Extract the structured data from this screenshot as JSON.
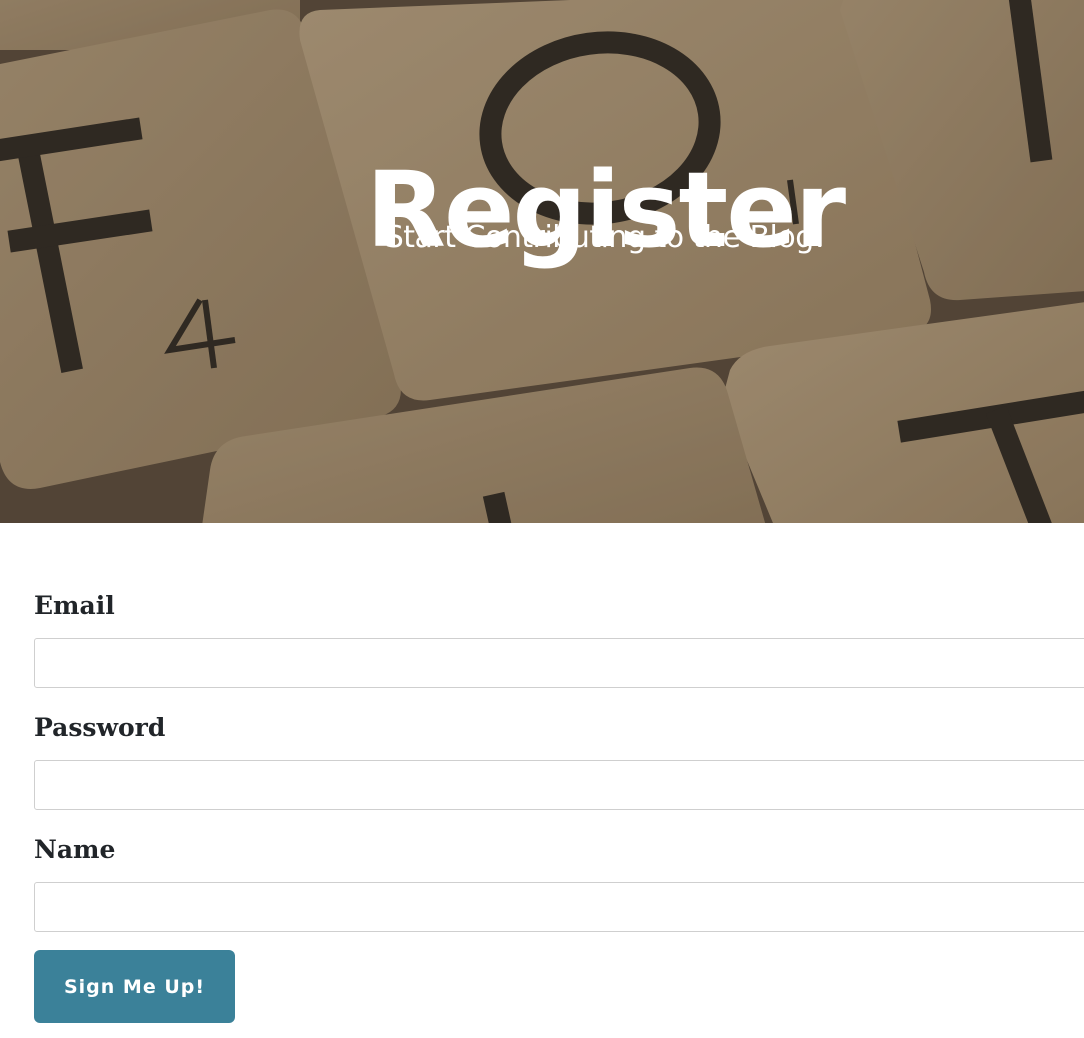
{
  "header": {
    "title": "Register",
    "subtitle": "Start Contributing to the Blog!"
  },
  "form": {
    "email": {
      "label": "Email",
      "value": "",
      "placeholder": ""
    },
    "password": {
      "label": "Password",
      "value": "",
      "placeholder": ""
    },
    "name": {
      "label": "Name",
      "value": "",
      "placeholder": ""
    },
    "submit_label": "Sign Me Up!"
  },
  "colors": {
    "accent": "#3b8199",
    "label_text": "#212529",
    "input_border": "#cfcfcf"
  },
  "background_image": {
    "subject": "wooden letter tiles",
    "tile_letters": [
      "F",
      "O",
      "H",
      "T"
    ],
    "tile_subscripts": [
      "4",
      "1"
    ]
  }
}
